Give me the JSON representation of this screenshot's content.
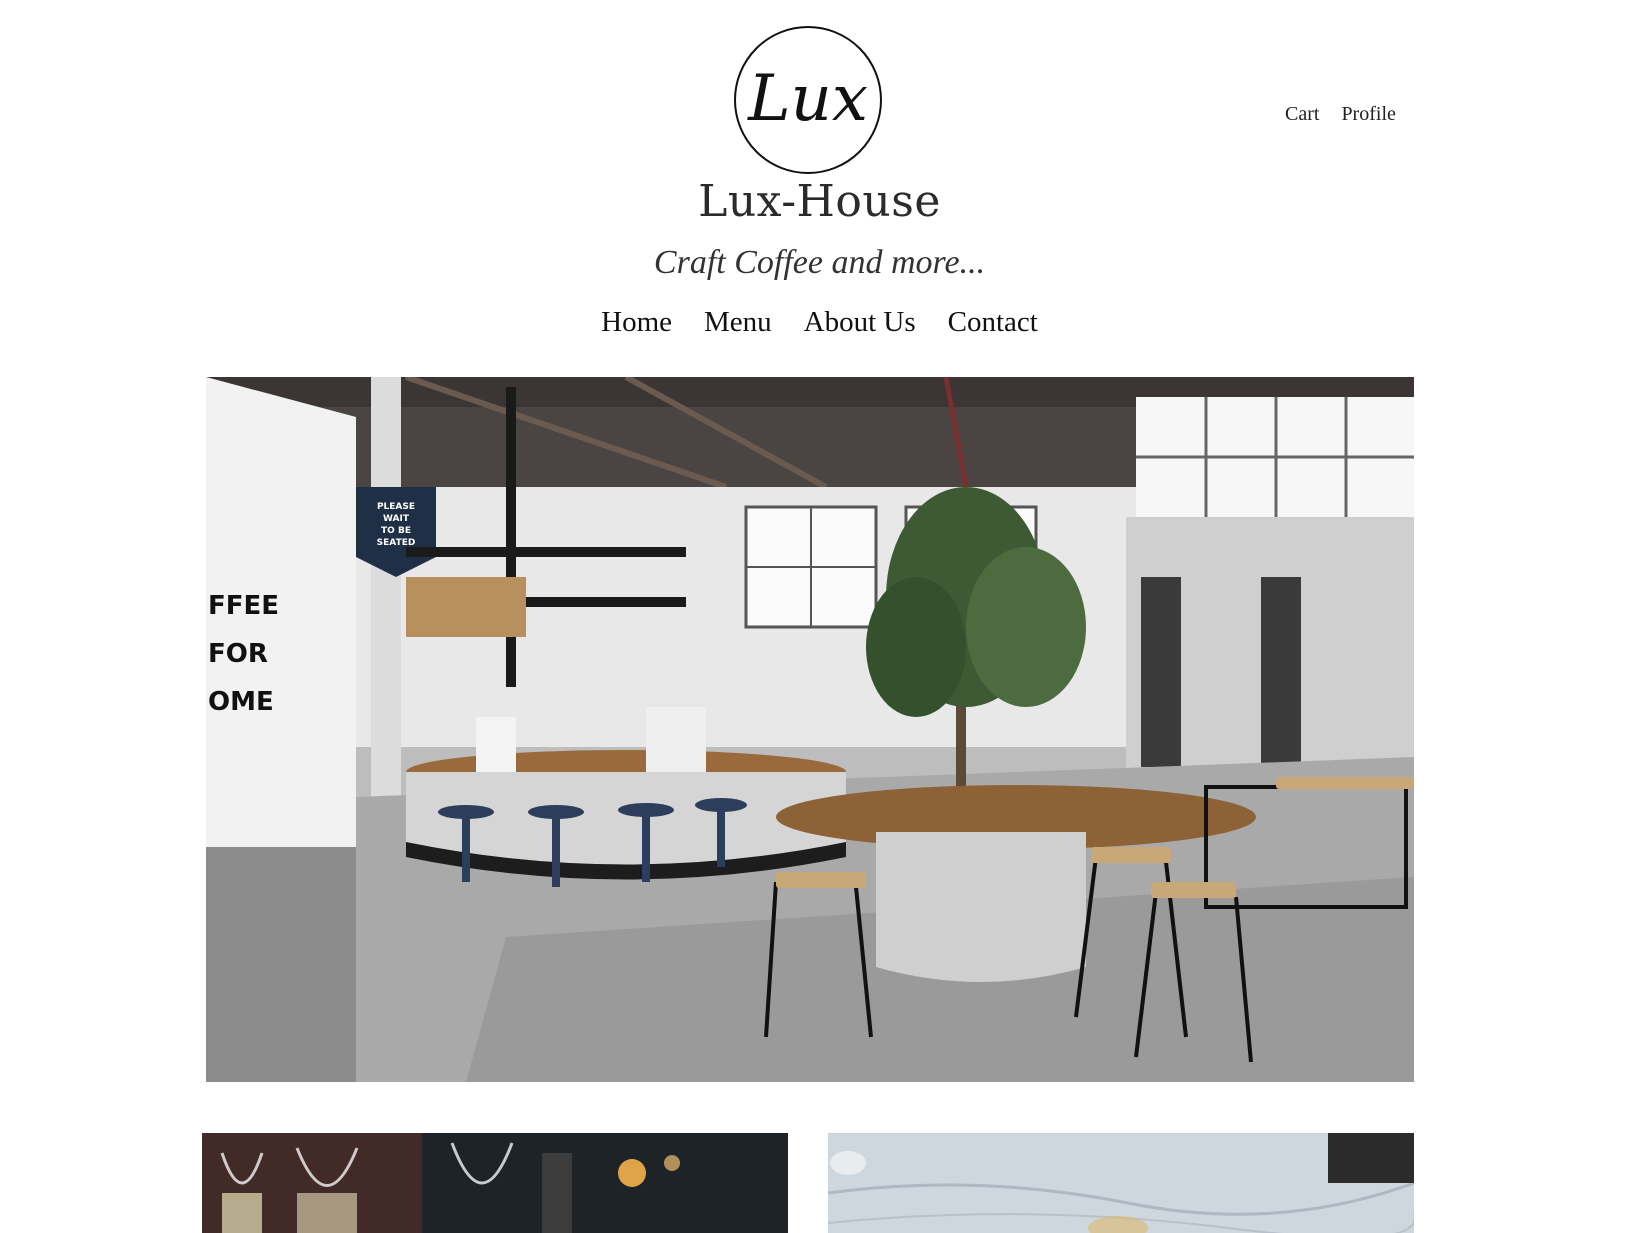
{
  "brand": {
    "logo_text": "Lux",
    "name": "Lux-House",
    "tagline": "Craft Coffee and more..."
  },
  "top_links": [
    {
      "label": "Cart"
    },
    {
      "label": "Profile"
    }
  ],
  "nav": [
    {
      "label": "Home"
    },
    {
      "label": "Menu"
    },
    {
      "label": "About Us"
    },
    {
      "label": "Contact"
    }
  ],
  "hero": {
    "image": "cafe-interior-photo",
    "sign_text": "PLEASE WAIT TO BE SEATED",
    "wall_letters": [
      "FFEE",
      "FOR",
      "OME"
    ]
  },
  "cards": [
    {
      "image": "wine-glasses-candle-photo"
    },
    {
      "image": "marble-table-photo"
    }
  ]
}
